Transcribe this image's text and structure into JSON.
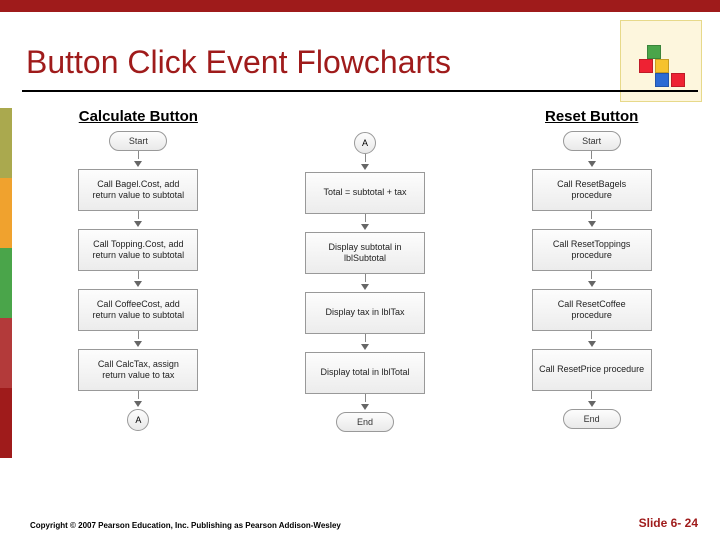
{
  "title": "Button Click Event Flowcharts",
  "columns": {
    "calc": {
      "heading": "Calculate Button",
      "flow1": {
        "start": "Start",
        "steps": [
          "Call Bagel.Cost, add return value to subtotal",
          "Call Topping.Cost, add return value to subtotal",
          "Call CoffeeCost, add return value to subtotal",
          "Call CalcTax, assign return value to tax"
        ],
        "end_conn": "A"
      },
      "flow2": {
        "start_conn": "A",
        "steps": [
          "Total = subtotal + tax",
          "Display subtotal in lblSubtotal",
          "Display tax in lblTax",
          "Display total in lblTotal"
        ],
        "end": "End"
      }
    },
    "reset": {
      "heading": "Reset Button",
      "flow": {
        "start": "Start",
        "steps": [
          "Call ResetBagels procedure",
          "Call ResetToppings procedure",
          "Call ResetCoffee procedure",
          "Call ResetPrice procedure"
        ],
        "end": "End"
      }
    }
  },
  "footer": {
    "copyright": "Copyright © 2007 Pearson Education, Inc. Publishing as Pearson Addison-Wesley",
    "slide": "Slide 6- 24"
  }
}
